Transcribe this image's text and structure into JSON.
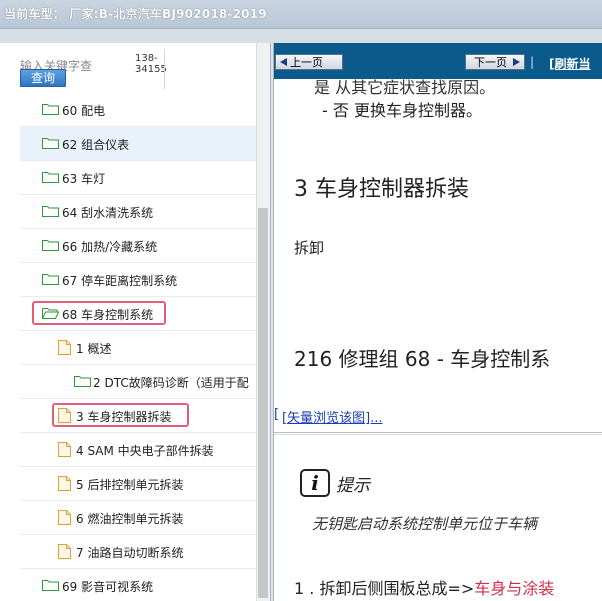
{
  "window": {
    "title": "当前车型：  厂家:B-北京汽车BJ902018-2019"
  },
  "search": {
    "placeholder": "输入关键字查",
    "button_label": "查询",
    "phone_line1": "138-",
    "phone_line2": "34155"
  },
  "tree": {
    "items": [
      {
        "label": "60 配电"
      },
      {
        "label": "62 组合仪表"
      },
      {
        "label": "63 车灯"
      },
      {
        "label": "64 刮水清洗系统"
      },
      {
        "label": "66 加热/冷藏系统"
      },
      {
        "label": "67 停车距离控制系统"
      },
      {
        "label": "68 车身控制系统"
      },
      {
        "label": "1 概述"
      },
      {
        "label": "2 DTC故障码诊断（适用于配"
      },
      {
        "label": "3 车身控制器拆装"
      },
      {
        "label": "4 SAM 中央电子部件拆装"
      },
      {
        "label": "5 后排控制单元拆装"
      },
      {
        "label": "6 燃油控制单元拆装"
      },
      {
        "label": "7 油路自动切断系统"
      },
      {
        "label": "69 影音可视系统"
      }
    ]
  },
  "nav": {
    "prev_label": "上一页",
    "next_label": "下一页",
    "separator": "|",
    "refresh_label": "[刷新当"
  },
  "content": {
    "partial_line": "是 从其它症状查找原因。",
    "bullet_line": "-  否 更换车身控制器。",
    "section_title": "3 车身控制器拆装",
    "remove_label": "拆卸",
    "page_ref": "216   修理组 68  - 车身控制系",
    "vector_link": "[矢量浏览该图]...",
    "vector_bracket": "[",
    "hint_icon": "i",
    "hint_label": "提示",
    "hint_text": "无钥匙启动系统控制单元位于车辆",
    "step_prefix": "1 . 拆卸后侧围板总成=>",
    "step_link": "车身与涂装"
  }
}
